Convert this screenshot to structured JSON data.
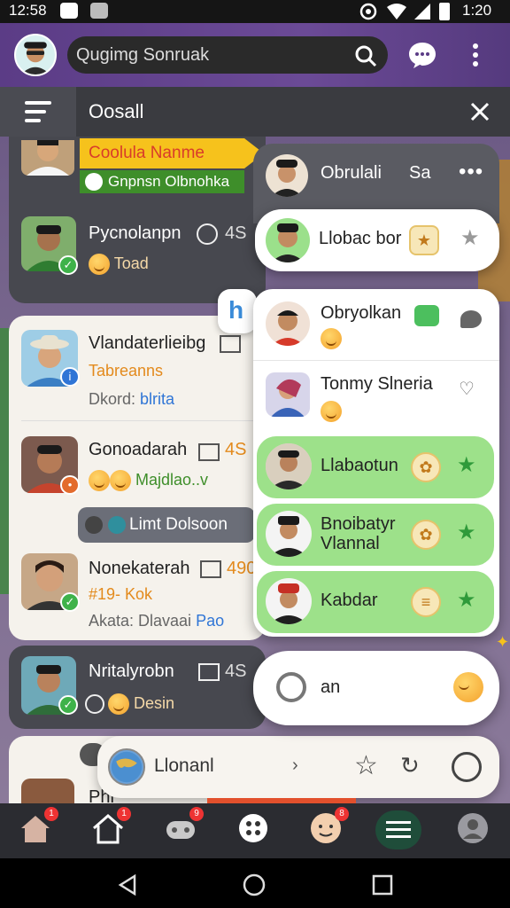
{
  "status_bar": {
    "time_left": "12:58",
    "time_right": "1:20"
  },
  "search": {
    "value": "Qugimg Sonruak"
  },
  "drawer": {
    "title": "Oosall"
  },
  "highlight_card": {
    "title": "Coolula Nanme",
    "subtitle": "Gnpnsn Olbnohka"
  },
  "left_cards": [
    {
      "name": "Pycnolanpn",
      "tag": "4S",
      "sub": "Toad"
    },
    {
      "name": "Vlandaterlieibg",
      "sub": "Tabreanns",
      "extra_label": "Dkord:",
      "extra_value": "blrita"
    },
    {
      "name": "Gonoadarah",
      "tag": "4S",
      "sub": "Majdlao..v"
    },
    {
      "name": "Nonekaterah",
      "tag": "490",
      "sub": "#19- Kok",
      "extra_label": "Akata: Dlavaai",
      "extra_value": "Pao"
    },
    {
      "name": "Nritalyrobn",
      "tag": "4S",
      "sub": "Desin"
    },
    {
      "name": "Phr"
    }
  ],
  "link_chip": {
    "label": "Limt Dolsoon"
  },
  "bottom_card": {
    "label": "Llonanl"
  },
  "panel": {
    "header_name": "Obrulali",
    "header_tag": "Sa",
    "top_contact": "Llobac bor",
    "small_chip": "h",
    "contacts": [
      {
        "name": "Obryolkan",
        "green": false
      },
      {
        "name": "Tonmy Slneria",
        "green": false
      },
      {
        "name": "Llabaotun",
        "green": true
      },
      {
        "name": "Bnoibatyr Vlannal",
        "green": true
      },
      {
        "name": "Kabdar",
        "green": true
      }
    ],
    "bottom_item": "an"
  },
  "nav_badges": [
    "1",
    "1",
    "9",
    "8"
  ],
  "colors": {
    "accent_purple": "#5b3c86",
    "highlight_yellow": "#f6c21c",
    "green_row": "#9de18a",
    "badge_red": "#e33333"
  }
}
